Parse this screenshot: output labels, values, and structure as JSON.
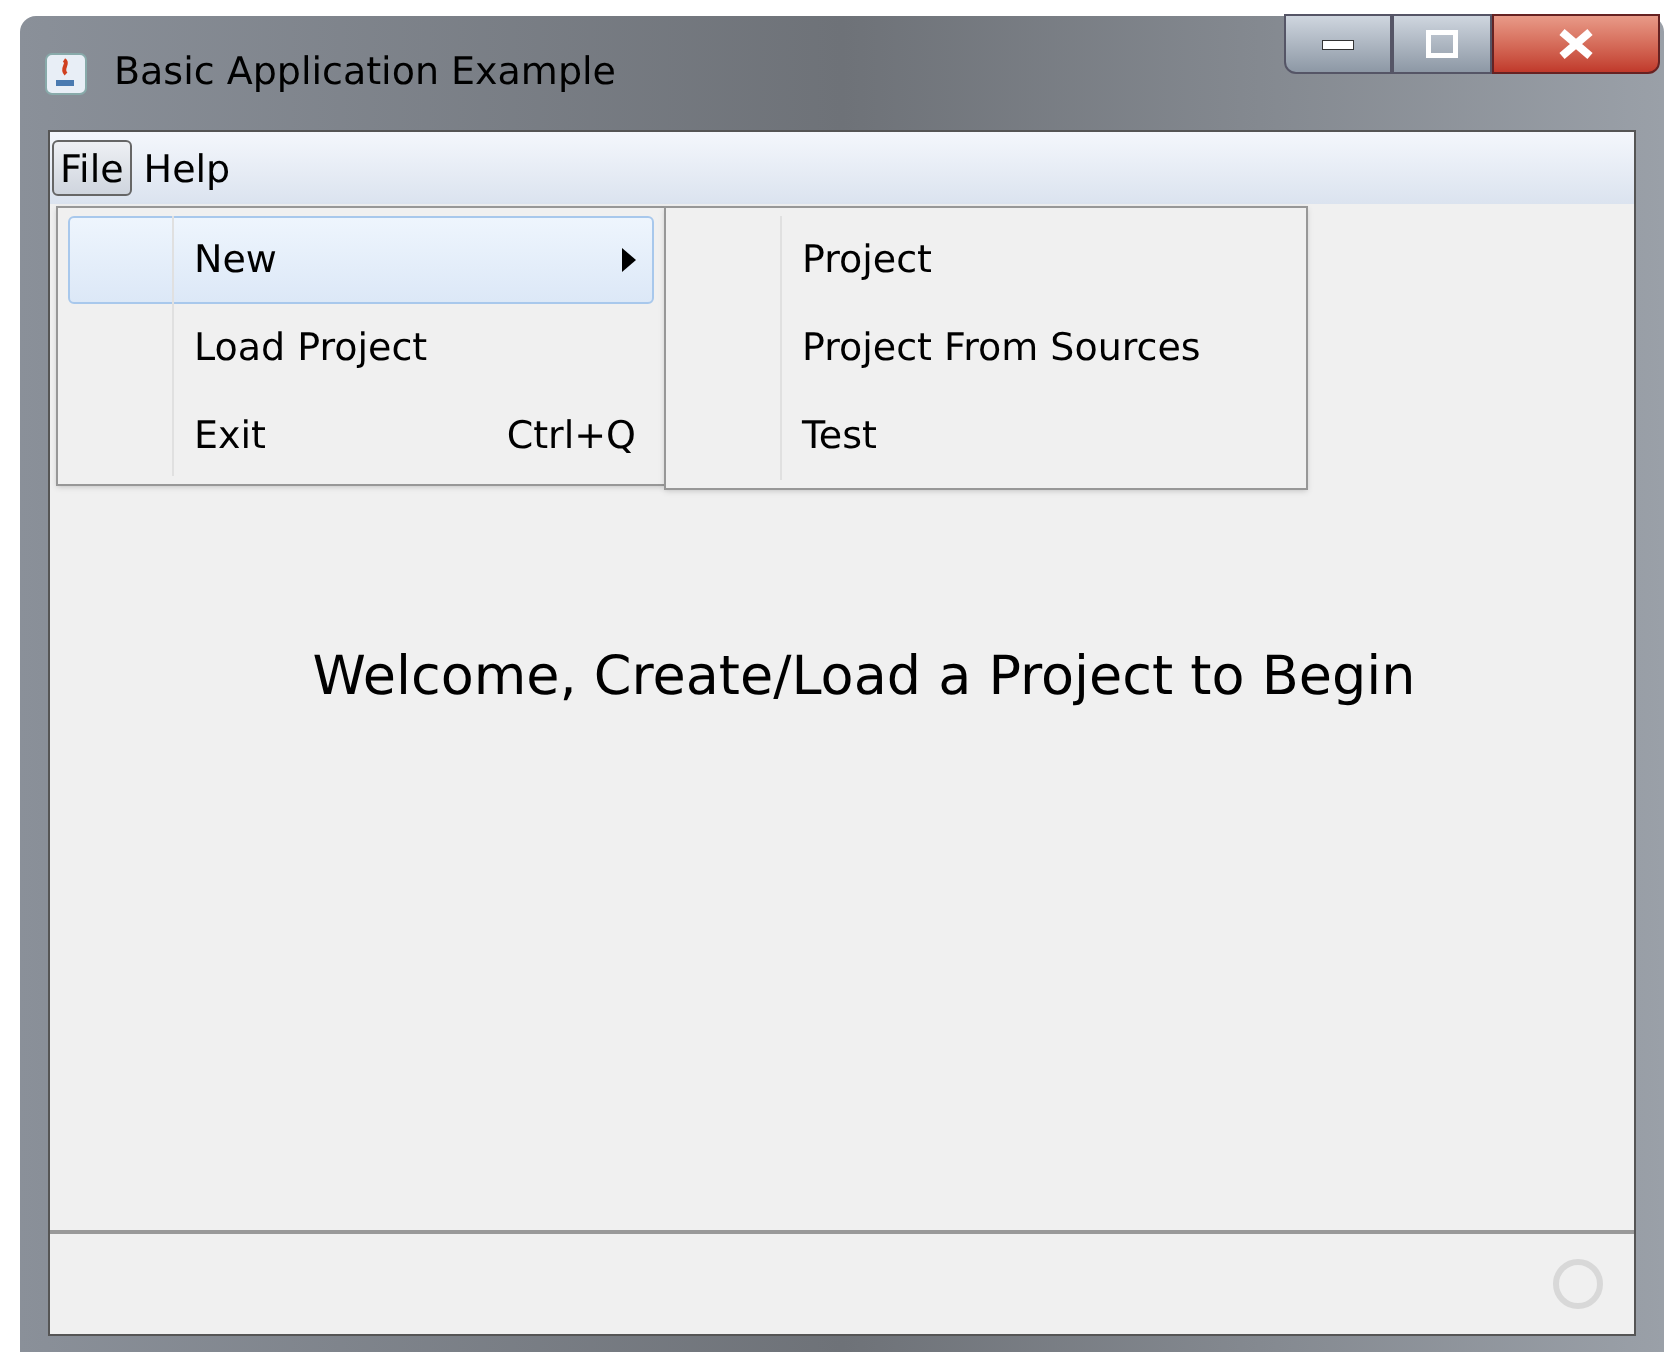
{
  "window": {
    "title": "Basic Application Example"
  },
  "menubar": [
    {
      "label": "File",
      "selected": true
    },
    {
      "label": "Help",
      "selected": false
    }
  ],
  "menu": [
    {
      "label": "New",
      "submenu": true,
      "selected": true
    },
    {
      "label": "Load Project",
      "submenu": false,
      "selected": false
    },
    {
      "label": "Exit",
      "shortcut": "Ctrl+Q",
      "submenu": false,
      "selected": false
    }
  ],
  "submenu": [
    {
      "label": "Project",
      "selected": false
    },
    {
      "label": "Project From Sources",
      "selected": false
    },
    {
      "label": "Test",
      "selected": false
    }
  ],
  "content": {
    "message": "Welcome, Create/Load a Project to Begin"
  }
}
